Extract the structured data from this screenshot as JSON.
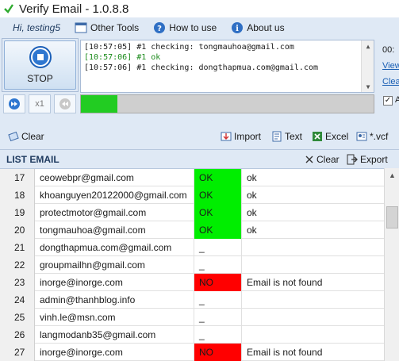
{
  "window": {
    "title": "Verify Email - 1.0.8.8"
  },
  "menu": {
    "greeting": "Hi, testing5",
    "items": [
      {
        "label": "Other Tools",
        "icon": "window-icon"
      },
      {
        "label": "How to use",
        "icon": "help-icon"
      },
      {
        "label": "About us",
        "icon": "info-icon"
      }
    ]
  },
  "controls": {
    "stop_label": "STOP",
    "speed_label": "x1"
  },
  "log": {
    "lines": [
      "[10:57:05] #1 checking: tongmauhoa@gmail.com",
      "[10:57:06] #1 ok",
      "[10:57:06] #1 checking: dongthapmua.com@gmail.com"
    ]
  },
  "right_panel": {
    "timer": "00:",
    "link1": "View",
    "link2": "Clea",
    "checkbox_label": "A"
  },
  "progress": {
    "fraction": 0.125
  },
  "toolbar": {
    "clear": "Clear",
    "import": "Import",
    "text": "Text",
    "excel": "Excel",
    "vcf": "*.vcf"
  },
  "list": {
    "title": "LIST EMAIL",
    "clear": "Clear",
    "export": "Export",
    "rows": [
      {
        "idx": "17",
        "email": "ceowebpr@gmail.com",
        "status": "OK",
        "msg": "ok"
      },
      {
        "idx": "18",
        "email": "khoanguyen20122000@gmail.com",
        "status": "OK",
        "msg": "ok"
      },
      {
        "idx": "19",
        "email": "protectmotor@gmail.com",
        "status": "OK",
        "msg": "ok"
      },
      {
        "idx": "20",
        "email": "tongmauhoa@gmail.com",
        "status": "OK",
        "msg": "ok"
      },
      {
        "idx": "21",
        "email": "dongthapmua.com@gmail.com",
        "status": "_",
        "msg": ""
      },
      {
        "idx": "22",
        "email": "groupmailhn@gmail.com",
        "status": "_",
        "msg": ""
      },
      {
        "idx": "23",
        "email": "inorge@inorge.com",
        "status": "NO",
        "msg": "Email is not found"
      },
      {
        "idx": "24",
        "email": "admin@thanhblog.info",
        "status": "_",
        "msg": ""
      },
      {
        "idx": "25",
        "email": "vinh.le@msn.com",
        "status": "_",
        "msg": ""
      },
      {
        "idx": "26",
        "email": "langmodanb35@gmail.com",
        "status": "_",
        "msg": ""
      },
      {
        "idx": "27",
        "email": "inorge@inorge.com",
        "status": "NO",
        "msg": "Email is not found"
      }
    ]
  },
  "colors": {
    "ok": "#00ee00",
    "no": "#ff0000",
    "progress": "#22cc22",
    "accent": "#1e3a5f"
  }
}
